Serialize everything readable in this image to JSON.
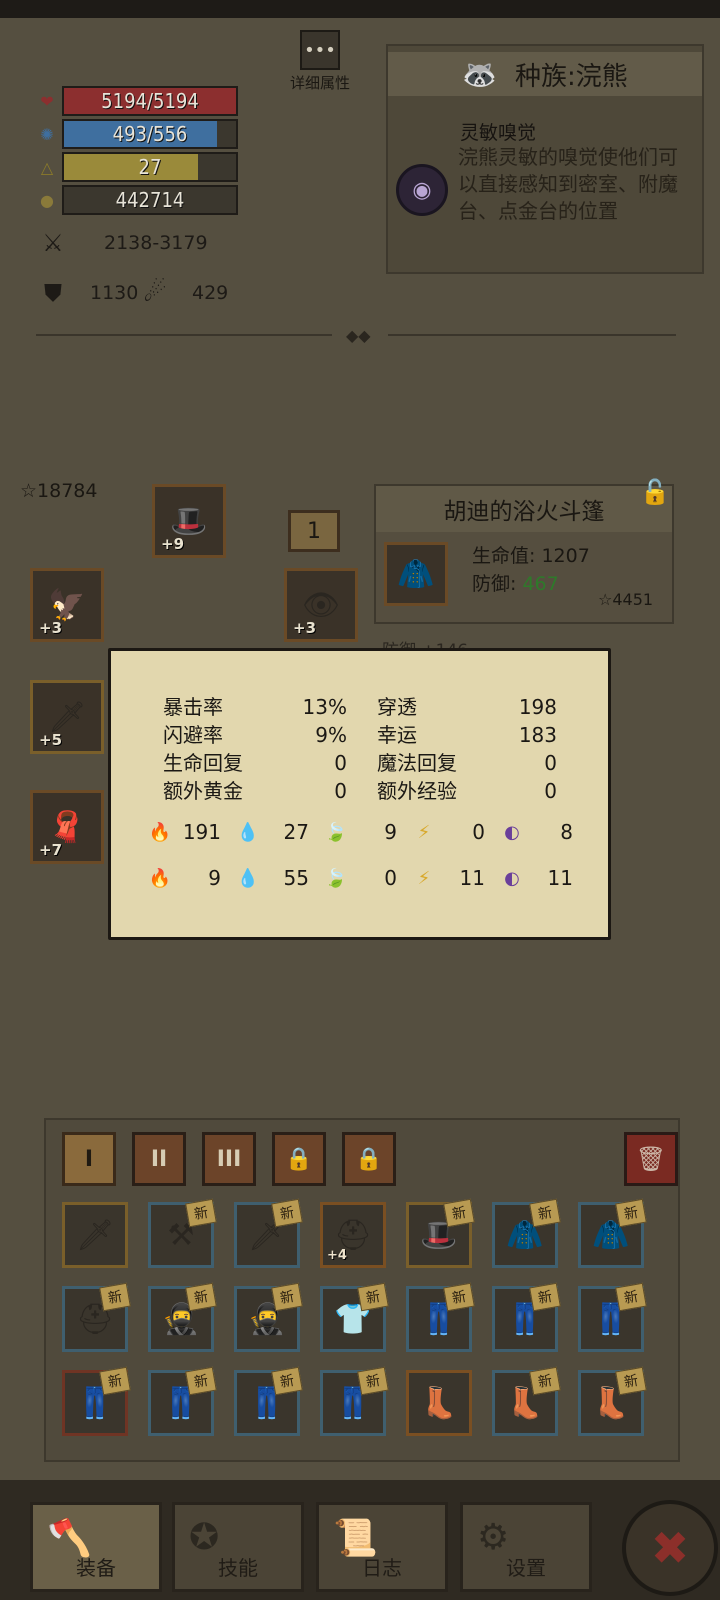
{
  "stats": {
    "hp": {
      "text": "5194/5194",
      "fill_fraction": 1.0,
      "color": "#8c2f2f"
    },
    "mp": {
      "text": "493/556",
      "fill_fraction": 0.89,
      "color": "#3f6f9f"
    },
    "level": {
      "text": "27",
      "fill_fraction": 0.78,
      "color": "#9a8a3a"
    },
    "gold": {
      "text": "442714",
      "fill_fraction": 0.0,
      "color": "#3b372e"
    },
    "attack": "2138-3179",
    "armor": "1130",
    "magic_resist": "429"
  },
  "detail_button": {
    "label": "详细属性"
  },
  "race": {
    "title": "种族:浣熊",
    "skill_name": "灵敏嗅觉",
    "skill_desc": "浣熊灵敏的嗅觉使他们可以直接感知到密室、附魔台、点金台的位置"
  },
  "equipment": {
    "total_score": "18784",
    "slots": [
      {
        "name": "helmet",
        "level": "+9",
        "icon": "helmet-icon"
      },
      {
        "name": "shoulder",
        "level": "+3",
        "icon": "shoulder-icon"
      },
      {
        "name": "trinket",
        "level": "+3",
        "icon": "eye-trinket-icon"
      },
      {
        "name": "weapon",
        "level": "+5",
        "icon": "sword-icon"
      },
      {
        "name": "cloak",
        "level": "+7",
        "icon": "cloak-icon"
      }
    ],
    "count_badge": "1"
  },
  "item_panel": {
    "title": "胡迪的浴火斗篷",
    "hp_label": "生命值:",
    "hp_value": "1207",
    "def_label": "防御:",
    "def_value": "467",
    "score": "4451",
    "extra": "防御 +146"
  },
  "tooltip": {
    "rows": [
      {
        "k1": "暴击率",
        "v1": "13%",
        "k2": "穿透",
        "v2": "198"
      },
      {
        "k1": "闪避率",
        "v1": "9%",
        "k2": "幸运",
        "v2": "183"
      },
      {
        "k1": "生命回复",
        "v1": "0",
        "k2": "魔法回复",
        "v2": "0"
      },
      {
        "k1": "额外黄金",
        "v1": "0",
        "k2": "额外经验",
        "v2": "0"
      }
    ],
    "attack_elements": [
      "191",
      "27",
      "9",
      "0",
      "8"
    ],
    "resist_elements": [
      "9",
      "55",
      "0",
      "11",
      "11"
    ]
  },
  "inventory": {
    "tabs": [
      "I",
      "II",
      "III",
      "🔒",
      "🔒"
    ],
    "new_label": "新",
    "items": [
      {
        "icon": "🗡",
        "new": false,
        "plus": "",
        "border": "gold"
      },
      {
        "icon": "⚒",
        "new": true,
        "plus": "",
        "border": "blue"
      },
      {
        "icon": "🗡",
        "new": true,
        "plus": "",
        "border": "blue"
      },
      {
        "icon": "⛑",
        "new": false,
        "plus": "+4",
        "border": "orange"
      },
      {
        "icon": "🎩",
        "new": true,
        "plus": "",
        "border": "gold"
      },
      {
        "icon": "🧥",
        "new": true,
        "plus": "",
        "border": "blue"
      },
      {
        "icon": "🧥",
        "new": true,
        "plus": "",
        "border": "blue"
      },
      {
        "icon": "⛑",
        "new": true,
        "plus": "",
        "border": "blue"
      },
      {
        "icon": "🥷",
        "new": true,
        "plus": "",
        "border": "blue"
      },
      {
        "icon": "🥷",
        "new": true,
        "plus": "",
        "border": "blue"
      },
      {
        "icon": "👕",
        "new": true,
        "plus": "",
        "border": "blue"
      },
      {
        "icon": "👖",
        "new": true,
        "plus": "",
        "border": "blue"
      },
      {
        "icon": "👖",
        "new": true,
        "plus": "",
        "border": "blue"
      },
      {
        "icon": "👖",
        "new": true,
        "plus": "",
        "border": "blue"
      },
      {
        "icon": "👖",
        "new": true,
        "plus": "",
        "border": "red"
      },
      {
        "icon": "👖",
        "new": true,
        "plus": "",
        "border": "blue"
      },
      {
        "icon": "👖",
        "new": true,
        "plus": "",
        "border": "blue"
      },
      {
        "icon": "👖",
        "new": true,
        "plus": "",
        "border": "blue"
      },
      {
        "icon": "👢",
        "new": false,
        "plus": "",
        "border": "orange"
      },
      {
        "icon": "👢",
        "new": true,
        "plus": "",
        "border": "blue"
      },
      {
        "icon": "👢",
        "new": true,
        "plus": "",
        "border": "blue"
      }
    ]
  },
  "nav": {
    "equip": "装备",
    "skills": "技能",
    "log": "日志",
    "settings": "设置",
    "close": "✖"
  }
}
